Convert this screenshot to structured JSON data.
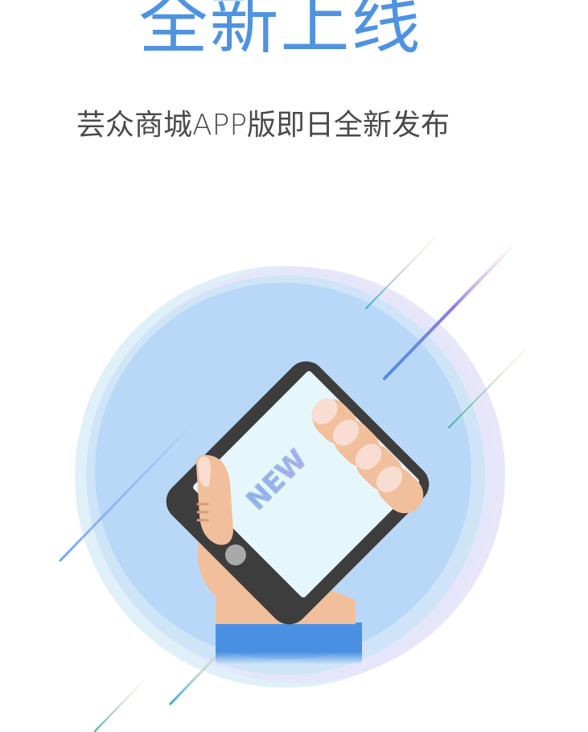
{
  "hero": {
    "title": "全新上线",
    "subtitle": "芸众商城APP版即日全新发布"
  },
  "illustration": {
    "badge_text": "NEW",
    "icons": [
      "hand-holding-phone-icon",
      "phone-home-button-icon",
      "speed-line-icon"
    ]
  },
  "colors": {
    "title": "#4f93e0",
    "subtitle": "#4a4a4a",
    "circle": "#b9d8f7",
    "phone_body": "#3d3d3d",
    "phone_screen": "#e6f7fc",
    "skin": "#f1bf9b",
    "nail": "#f9ddd2",
    "sleeve": "#4a90e2"
  }
}
